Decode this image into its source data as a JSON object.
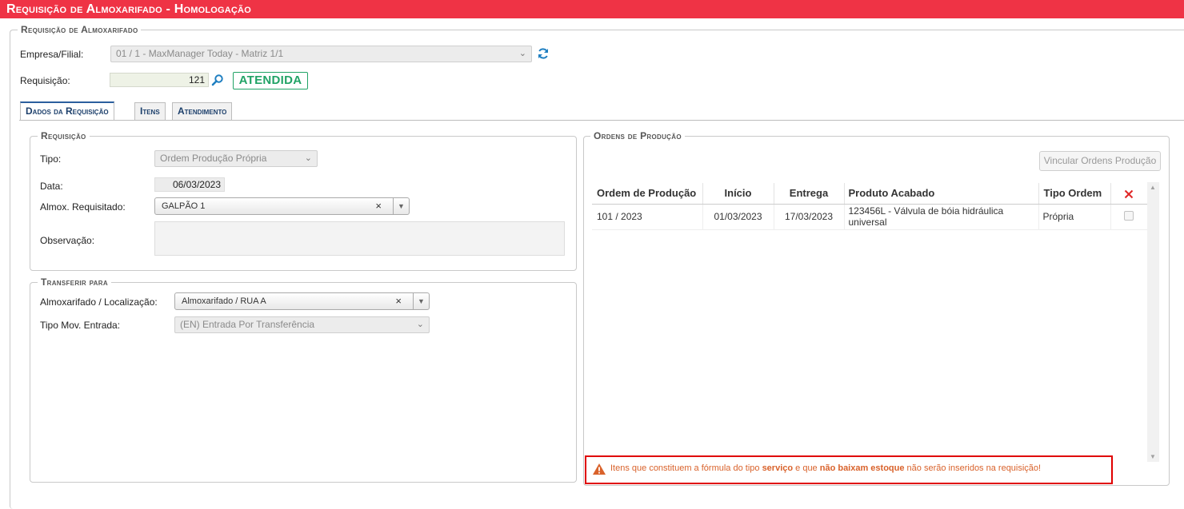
{
  "window": {
    "title": "Requisição de Almoxarifado  - Homologação"
  },
  "header": {
    "legend": "Requisição de Almoxarifado",
    "empresa_label": "Empresa/Filial:",
    "empresa_value": "01 / 1 - MaxManager Today - Matriz 1/1",
    "requisicao_label": "Requisição:",
    "requisicao_value": "121",
    "status_badge": "ATENDIDA"
  },
  "tabs": [
    {
      "label": "Dados da Requisição"
    },
    {
      "label": "Itens"
    },
    {
      "label": "Atendimento"
    }
  ],
  "requisicao": {
    "legend": "Requisição",
    "tipo_label": "Tipo:",
    "tipo_value": "Ordem Produção Própria",
    "data_label": "Data:",
    "data_value": "06/03/2023",
    "almox_label": "Almox. Requisitado:",
    "almox_value": "GALPÃO 1",
    "obs_label": "Observação:",
    "obs_value": ""
  },
  "transferir": {
    "legend": "Transferir para",
    "almox_loc_label": "Almoxarifado / Localização:",
    "almox_loc_value": "Almoxarifado / RUA A",
    "tipo_mov_label": "Tipo Mov. Entrada:",
    "tipo_mov_value": "(EN) Entrada Por Transferência"
  },
  "ordens": {
    "legend": "Ordens de Produção",
    "vincular_button": "Vincular Ordens Produção",
    "columns": [
      "Ordem de Produção",
      "Início",
      "Entrega",
      "Produto Acabado",
      "Tipo Ordem"
    ],
    "rows": [
      {
        "ordem": "101 / 2023",
        "inicio": "01/03/2023",
        "entrega": "17/03/2023",
        "produto": "123456L - Válvula de bóia hidráulica universal",
        "tipo": "Própria",
        "checked": false
      }
    ],
    "warning": {
      "part1": "Itens que constituem a fórmula do tipo ",
      "bold1": "serviço",
      "part2": " e que ",
      "bold2": "não baixam estoque",
      "part3": " não serão inseridos na requisição!"
    }
  },
  "colors": {
    "titlebar": "#ef3345",
    "status_green": "#21a366",
    "link_blue": "#1f7fc1",
    "warning_orange": "#d9622b",
    "warning_border": "#e00000",
    "delete_red": "#e02727"
  }
}
